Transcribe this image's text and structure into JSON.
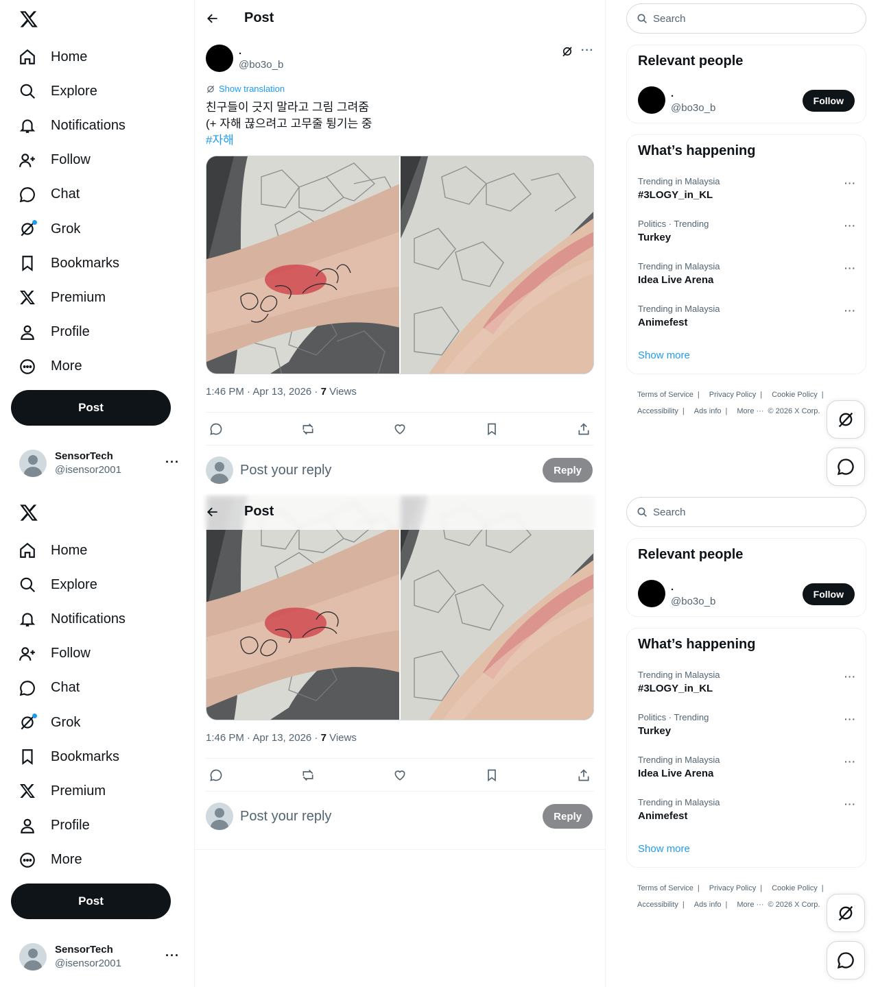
{
  "nav": {
    "items": [
      {
        "label": "Home",
        "icon": "home-icon"
      },
      {
        "label": "Explore",
        "icon": "search-icon"
      },
      {
        "label": "Notifications",
        "icon": "bell-icon"
      },
      {
        "label": "Follow",
        "icon": "person-add-icon"
      },
      {
        "label": "Chat",
        "icon": "chat-bubble-icon"
      },
      {
        "label": "Grok",
        "icon": "grok-icon"
      },
      {
        "label": "Bookmarks",
        "icon": "bookmark-icon"
      },
      {
        "label": "Premium",
        "icon": "x-logo-icon"
      },
      {
        "label": "Profile",
        "icon": "person-icon"
      },
      {
        "label": "More",
        "icon": "more-circle-icon"
      }
    ],
    "post_label": "Post"
  },
  "account": {
    "name": "SensorTech",
    "handle": "@isensor2001",
    "more": "···"
  },
  "header": {
    "title": "Post"
  },
  "post": {
    "author_name": ".",
    "author_handle": "@bo3o_b",
    "show_translation": "Show translation",
    "line1": "친구들이 긋지 말라고 그림 그려줌",
    "line2": "(+ 자해 끊으려고 고무줄 튕기는 중",
    "hashtag": "#자해",
    "time": "1:46 PM · Apr 13, 2026 · ",
    "views_count": "7",
    "views_label": " Views",
    "more": "···"
  },
  "reply": {
    "placeholder": "Post your reply",
    "button": "Reply"
  },
  "search": {
    "placeholder": "Search"
  },
  "relevant": {
    "title": "Relevant people",
    "name": ".",
    "handle": "@bo3o_b",
    "follow": "Follow"
  },
  "trends": {
    "title": "What’s happening",
    "items": [
      {
        "meta": "Trending in Malaysia",
        "name": "#3LOGY_in_KL"
      },
      {
        "meta": "Politics · Trending",
        "name": "Turkey"
      },
      {
        "meta": "Trending in Malaysia",
        "name": "Idea Live Arena"
      },
      {
        "meta": "Trending in Malaysia",
        "name": "Animefest"
      }
    ],
    "more_icon": "···",
    "show_more": "Show more"
  },
  "footer": {
    "terms": "Terms of Service",
    "privacy": "Privacy Policy",
    "cookie": "Cookie Policy",
    "accessibility": "Accessibility",
    "ads": "Ads info",
    "more": "More ···",
    "copyright": "© 2026 X Corp."
  },
  "colors": {
    "accent": "#1d9bf0",
    "text": "#0f1419",
    "secondary": "#536471",
    "border": "#eff3f4"
  }
}
